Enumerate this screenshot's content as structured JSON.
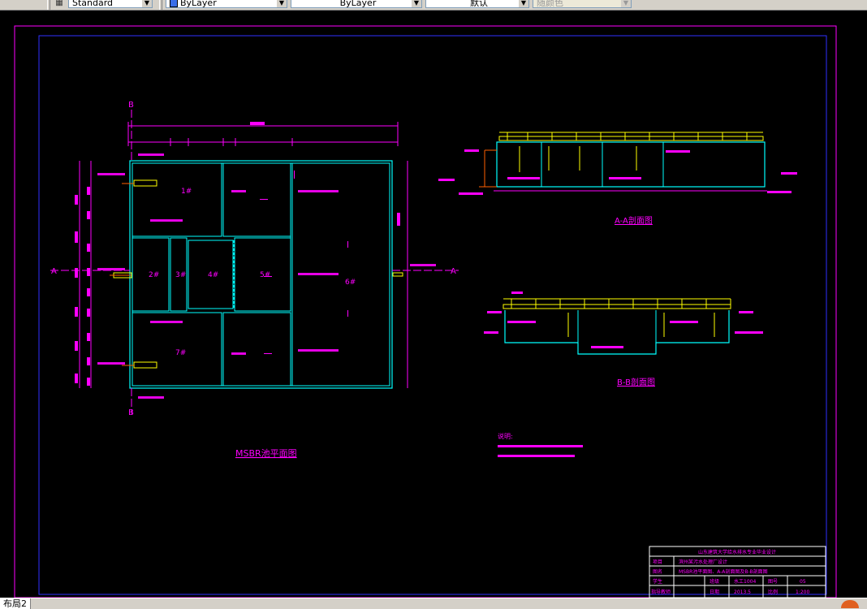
{
  "toolbar": {
    "textstyle_value": "Standard",
    "layer_value": "ByLayer",
    "linetype_value": "ByLayer",
    "lineweight_value": "默认",
    "plotstyle_value": "随颜色",
    "accent_color": "#3a6ee8"
  },
  "drawing": {
    "plan_title": "MSBR池平面图",
    "section_aa_title": "A-A剖面图",
    "section_bb_title": "B-B剖面图",
    "section_marker_a": "A",
    "section_marker_b": "B",
    "notes_heading": "说明:",
    "cells": [
      "1#",
      "2#",
      "3#",
      "4#",
      "5#",
      "6#",
      "7#"
    ],
    "title_block": {
      "school": "山东建筑大学给水排水专业毕业设计",
      "row_project_label": "项目",
      "row_project_value": "滨州某污水处理厂设计",
      "row_drawing_label": "图名",
      "row_drawing_value": "MSBR池平面图、A-A剖面图及B-B剖面图",
      "row_student_label": "学生",
      "row_class_label": "班级",
      "row_class_value": "水工1004",
      "row_no_label": "图号",
      "row_no_value": "05",
      "row_teacher_label": "指导教师",
      "row_date_label": "日期",
      "row_date_value": "2013.5",
      "row_scale_label": "比例",
      "row_scale_value": "1:200"
    }
  },
  "statusbar": {
    "layout_tab": "布局2"
  }
}
